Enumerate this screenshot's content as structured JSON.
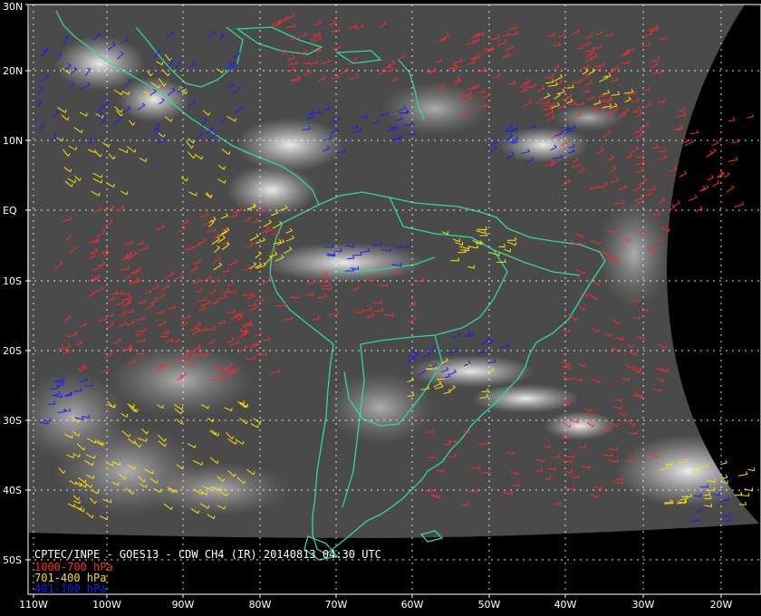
{
  "caption": {
    "title": "CPTEC/INPE - GOES13 - CDW CH4 (IR) 20140813 04:30 UTC"
  },
  "legend": [
    {
      "label": "1000-700 hPa",
      "color": "#ff2a2a"
    },
    {
      "label": "701-400 hPa",
      "color": "#ffe000"
    },
    {
      "label": "401-100 hPa",
      "color": "#1a1aff"
    }
  ],
  "lat_labels": [
    "30N",
    "20N",
    "10N",
    "EQ",
    "10S",
    "20S",
    "30S",
    "40S",
    "50S"
  ],
  "lon_labels": [
    "110W",
    "100W",
    "90W",
    "80W",
    "70W",
    "60W",
    "50W",
    "40W",
    "30W",
    "20W"
  ],
  "colors": {
    "coast": "#2fd8a0",
    "grid": "#ffffff",
    "frame": "#ffffff"
  }
}
